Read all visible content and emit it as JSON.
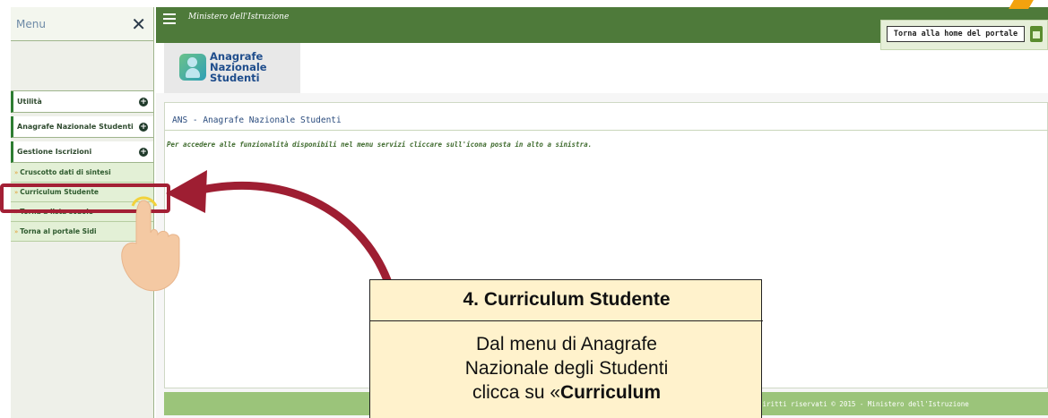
{
  "sidebar": {
    "title": "Menu",
    "close": "✕",
    "items": [
      {
        "label": "Utilità"
      },
      {
        "label": "Anagrafe Nazionale Studenti"
      },
      {
        "label": "Gestione Iscrizioni"
      }
    ],
    "subitems": [
      {
        "label": "Cruscotto dati di sintesi"
      },
      {
        "label": "Curriculum Studente"
      },
      {
        "label": "Torna a lista scuole"
      },
      {
        "label": "Torna al portale Sidi"
      }
    ],
    "sub_arrow": "»"
  },
  "header": {
    "ministry": "Ministero dell'Istruzione",
    "portal_button": "Torna alla home del portale"
  },
  "logo": {
    "line1": "Anagrafe",
    "line2": "Nazionale",
    "line3": "Studenti"
  },
  "main": {
    "panel_title": "ANS - Anagrafe Nazionale Studenti",
    "hint": "Per accedere alle funzionalità disponibili nel menu servizi cliccare sull'icona posta in alto a sinistra.",
    "footer": "diritti riservati © 2015 -  Ministero dell'Istruzione"
  },
  "callout": {
    "title": "4. Curriculum Studente",
    "line1": "Dal menu di Anagrafe",
    "line2": "Nazionale degli Studenti",
    "line3_prefix": "clicca su «",
    "line3_bold": "Curriculum"
  },
  "colors": {
    "topbar": "#4e7a3a",
    "highlight": "#a32035",
    "callout_bg": "#fff2cc",
    "accent": "#f2a20e"
  }
}
